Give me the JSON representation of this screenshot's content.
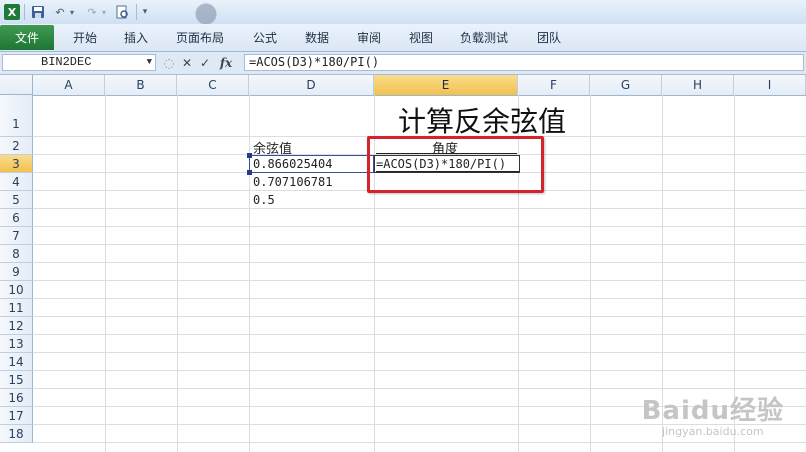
{
  "app": {
    "logo_letter": "X"
  },
  "quick_access": {
    "save_icon": "save-icon",
    "undo_icon": "undo-icon",
    "redo_icon": "redo-icon",
    "preview_icon": "print-preview-icon",
    "customize_icon": "customize-qat-icon"
  },
  "tabs": [
    "文件",
    "开始",
    "插入",
    "页面布局",
    "公式",
    "数据",
    "审阅",
    "视图",
    "负载测试",
    "团队"
  ],
  "formula_bar": {
    "name_box": "BIN2DEC",
    "cancel_symbol": "✕",
    "enter_symbol": "✓",
    "fx_label": "fx",
    "formula": "=ACOS(D3)*180/PI()"
  },
  "columns": [
    "A",
    "B",
    "C",
    "D",
    "E",
    "F",
    "G",
    "H",
    "I"
  ],
  "active_column": "E",
  "rows": [
    "1",
    "2",
    "3",
    "4",
    "5",
    "6",
    "7",
    "8",
    "9",
    "10",
    "11",
    "12",
    "13",
    "14",
    "15",
    "16",
    "17",
    "18"
  ],
  "active_row": "3",
  "sheet": {
    "title": "计算反余弦值",
    "header_cosine": "余弦值",
    "header_angle": "角度",
    "values": [
      "0.866025404",
      "0.707106781",
      "0.5"
    ],
    "editing_formula": "=ACOS(D3)*180/PI()"
  },
  "highlight_color": "#d3242b",
  "watermark": {
    "main": "Baidu经验",
    "sub": "jingyan.baidu.com"
  }
}
